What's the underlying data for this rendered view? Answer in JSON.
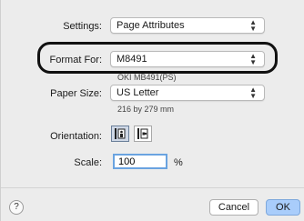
{
  "settings": {
    "label": "Settings:",
    "value": "Page Attributes"
  },
  "format_for": {
    "label": "Format For:",
    "value": "M8491",
    "subtext": "OKI MB491(PS)"
  },
  "paper_size": {
    "label": "Paper Size:",
    "value": "US Letter",
    "dimensions": "216 by 279 mm"
  },
  "orientation": {
    "label": "Orientation:",
    "selected": "portrait"
  },
  "scale": {
    "label": "Scale:",
    "value": "100",
    "unit": "%"
  },
  "footer": {
    "help_label": "?",
    "cancel_label": "Cancel",
    "ok_label": "OK"
  },
  "colors": {
    "highlight": "#111111",
    "ok_button": "#a9cdfb",
    "scale_focus": "#6aa3e0"
  }
}
